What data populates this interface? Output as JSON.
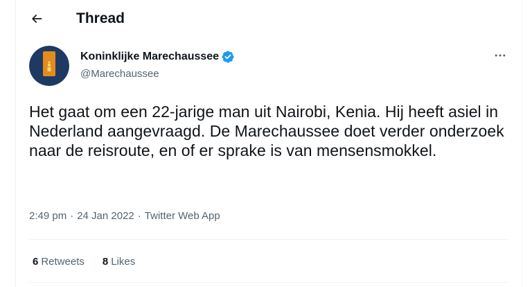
{
  "header": {
    "title": "Thread",
    "back_icon": "arrow-left-icon"
  },
  "tweet": {
    "author": {
      "name": "Koninklijke Marechaussee",
      "handle": "@Marechaussee",
      "verified": true,
      "avatar_colors": {
        "background": "#1e3a63",
        "badge": "#e38b1c"
      }
    },
    "more_icon": "more-horizontal-icon",
    "text": "Het gaat om een 22-jarige man uit Nairobi, Kenia. Hij heeft asiel in Nederland aangevraagd. De Marechaussee doet verder onderzoek naar de reisroute, en of er sprake is van mensensmokkel.",
    "time": "2:49 pm",
    "separator": "·",
    "date": "24 Jan 2022",
    "source": "Twitter Web App",
    "stats": {
      "retweets_count": "6",
      "retweets_label": "Retweets",
      "likes_count": "8",
      "likes_label": "Likes"
    }
  },
  "colors": {
    "text_primary": "#0f1419",
    "text_secondary": "#536471",
    "verified_blue": "#1d9bf0",
    "divider": "#eff3f4"
  }
}
